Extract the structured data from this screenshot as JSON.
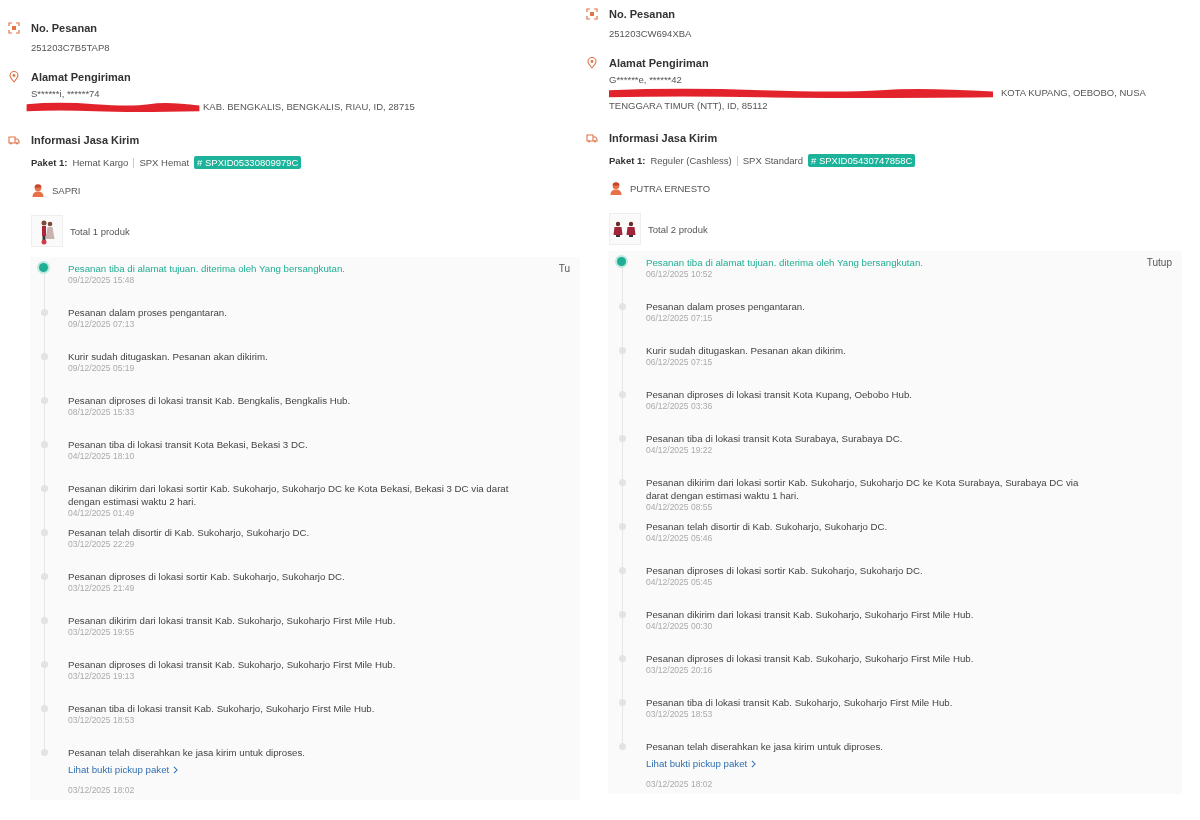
{
  "panels": [
    {
      "order": {
        "label": "No. Pesanan",
        "value": "251203C7B5TAP8"
      },
      "address": {
        "label": "Alamat Pengiriman",
        "recipient": "S******i, ******74",
        "redacted": true,
        "lines": [
          "KAB. BENGKALIS, BENGKALIS, RIAU, ID, 28715"
        ]
      },
      "shipping": {
        "label": "Informasi Jasa Kirim",
        "package_label": "Paket 1:",
        "service": "Hemat Kargo",
        "courier": "SPX Hemat",
        "tracking": "# SPXID05330809979C",
        "driver": "SAPRI",
        "products": "Total 1 produk"
      },
      "close": "Tu",
      "events": [
        {
          "text": "Pesanan tiba di alamat tujuan. diterima oleh Yang bersangkutan.",
          "time": "09/12/2025 15:48",
          "active": true
        },
        {
          "text": "Pesanan dalam proses pengantaran.",
          "time": "09/12/2025 07:13",
          "active": false
        },
        {
          "text": "Kurir sudah ditugaskan. Pesanan akan dikirim.",
          "time": "09/12/2025 05:19",
          "active": false
        },
        {
          "text": "Pesanan diproses di lokasi transit Kab. Bengkalis, Bengkalis Hub.",
          "time": "08/12/2025 15:33",
          "active": false
        },
        {
          "text": "Pesanan tiba di lokasi transit Kota Bekasi, Bekasi 3 DC.",
          "time": "04/12/2025 18:10",
          "active": false
        },
        {
          "text": "Pesanan dikirim dari lokasi sortir Kab. Sukoharjo, Sukoharjo DC ke Kota Bekasi, Bekasi 3 DC via darat dengan estimasi waktu 2 hari.",
          "time": "04/12/2025 01:49",
          "active": false
        },
        {
          "text": "Pesanan telah disortir di Kab. Sukoharjo, Sukoharjo DC.",
          "time": "03/12/2025 22:29",
          "active": false
        },
        {
          "text": "Pesanan diproses di lokasi sortir Kab. Sukoharjo, Sukoharjo DC.",
          "time": "03/12/2025 21:49",
          "active": false
        },
        {
          "text": "Pesanan dikirim dari lokasi transit Kab. Sukoharjo, Sukoharjo First Mile Hub.",
          "time": "03/12/2025 19:55",
          "active": false
        },
        {
          "text": "Pesanan diproses di lokasi transit Kab. Sukoharjo, Sukoharjo First Mile Hub.",
          "time": "03/12/2025 19:13",
          "active": false
        },
        {
          "text": "Pesanan tiba di lokasi transit Kab. Sukoharjo, Sukoharjo First Mile Hub.",
          "time": "03/12/2025 18:53",
          "active": false
        },
        {
          "text": "Pesanan telah diserahkan ke jasa kirim untuk diproses.",
          "link": "Lihat bukti pickup paket",
          "time": "03/12/2025 18:02",
          "active": false
        }
      ]
    },
    {
      "order": {
        "label": "No. Pesanan",
        "value": "251203CW694XBA"
      },
      "address": {
        "label": "Alamat Pengiriman",
        "recipient": "G******e, ******42",
        "redacted": true,
        "lines": [
          "KOTA KUPANG, OEBOBO, NUSA",
          "TENGGARA TIMUR (NTT), ID, 85112"
        ]
      },
      "shipping": {
        "label": "Informasi Jasa Kirim",
        "package_label": "Paket 1:",
        "service": "Reguler (Cashless)",
        "courier": "SPX Standard",
        "tracking": "# SPXID05430747858C",
        "driver": "PUTRA ERNESTO",
        "products": "Total 2 produk"
      },
      "close": "Tutup",
      "events": [
        {
          "text": "Pesanan tiba di alamat tujuan. diterima oleh Yang bersangkutan.",
          "time": "06/12/2025 10:52",
          "active": true
        },
        {
          "text": "Pesanan dalam proses pengantaran.",
          "time": "06/12/2025 07:15",
          "active": false
        },
        {
          "text": "Kurir sudah ditugaskan. Pesanan akan dikirim.",
          "time": "06/12/2025 07:15",
          "active": false
        },
        {
          "text": "Pesanan diproses di lokasi transit Kota Kupang, Oebobo Hub.",
          "time": "06/12/2025 03:36",
          "active": false
        },
        {
          "text": "Pesanan tiba di lokasi transit Kota Surabaya, Surabaya DC.",
          "time": "04/12/2025 19:22",
          "active": false
        },
        {
          "text": "Pesanan dikirim dari lokasi sortir Kab. Sukoharjo, Sukoharjo DC ke Kota Surabaya, Surabaya DC via darat dengan estimasi waktu 1 hari.",
          "time": "04/12/2025 08:55",
          "active": false
        },
        {
          "text": "Pesanan telah disortir di Kab. Sukoharjo, Sukoharjo DC.",
          "time": "04/12/2025 05:46",
          "active": false
        },
        {
          "text": "Pesanan diproses di lokasi sortir Kab. Sukoharjo, Sukoharjo DC.",
          "time": "04/12/2025 05:45",
          "active": false
        },
        {
          "text": "Pesanan dikirim dari lokasi transit Kab. Sukoharjo, Sukoharjo First Mile Hub.",
          "time": "04/12/2025 00:30",
          "active": false
        },
        {
          "text": "Pesanan diproses di lokasi transit Kab. Sukoharjo, Sukoharjo First Mile Hub.",
          "time": "03/12/2025 20:16",
          "active": false
        },
        {
          "text": "Pesanan tiba di lokasi transit Kab. Sukoharjo, Sukoharjo First Mile Hub.",
          "time": "03/12/2025 18:53",
          "active": false
        },
        {
          "text": "Pesanan telah diserahkan ke jasa kirim untuk diproses.",
          "link": "Lihat bukti pickup paket",
          "time": "03/12/2025 18:02",
          "active": false
        }
      ]
    }
  ]
}
